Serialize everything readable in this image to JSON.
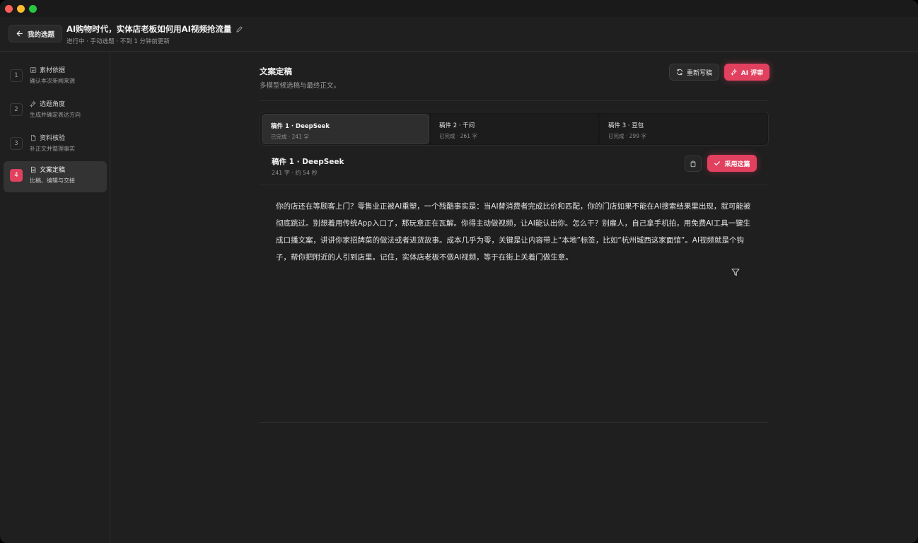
{
  "header": {
    "back_label": "我的选题",
    "title": "AI购物时代，实体店老板如何用AI视频抢流量",
    "subtitle": "进行中 · 手动选题 · 不到 1 分钟前更新"
  },
  "sidebar": {
    "steps": [
      {
        "num": "1",
        "title": "素材依据",
        "sub": "确认本次新闻来源",
        "icon": "news-icon"
      },
      {
        "num": "2",
        "title": "选题角度",
        "sub": "生成并确定表达方向",
        "icon": "sparkle-icon"
      },
      {
        "num": "3",
        "title": "资料核验",
        "sub": "补正文并整理事实",
        "icon": "file-icon"
      },
      {
        "num": "4",
        "title": "文案定稿",
        "sub": "比稿、编辑与交接",
        "icon": "document-icon",
        "active": true
      }
    ]
  },
  "main": {
    "title": "文案定稿",
    "subtitle": "多模型候选稿与最终正文。",
    "rewrite_label": "重新写稿",
    "review_label": "AI 评审",
    "tabs": [
      {
        "title": "稿件 1 · DeepSeek",
        "sub": "已完成 · 241 字",
        "active": true
      },
      {
        "title": "稿件 2 · 千问",
        "sub": "已完成 · 261 字"
      },
      {
        "title": "稿件 3 · 豆包",
        "sub": "已完成 · 299 字"
      }
    ],
    "draft": {
      "title": "稿件 1 · DeepSeek",
      "meta": "241 字 · 约 54 秒",
      "adopt_label": "采用这篇",
      "text": "你的店还在等顾客上门？零售业正被AI重塑，一个残酷事实是：当AI替消费者完成比价和匹配，你的门店如果不能在AI搜索结果里出现，就可能被彻底跳过。别想着用传统App入口了，那玩意正在瓦解。你得主动做视频，让AI能认出你。怎么干？别雇人，自己拿手机拍，用免费AI工具一键生成口播文案，讲讲你家招牌菜的做法或者进货故事。成本几乎为零，关键是让内容带上“本地”标签，比如“杭州城西这家面馆”。AI视频就是个钩子，帮你把附近的人引到店里。记住，实体店老板不做AI视频，等于在街上关着门做生意。"
    }
  },
  "colors": {
    "accent": "#e2405f",
    "background": "#1f1f1f"
  }
}
